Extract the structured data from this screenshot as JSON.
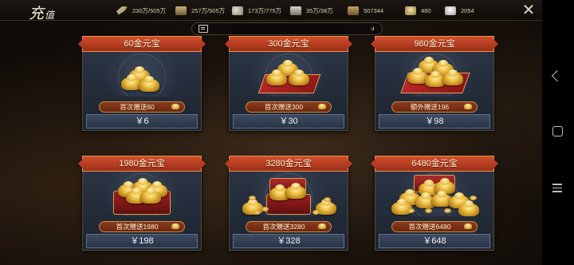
{
  "header": {
    "title_main": "充",
    "title_sub": "值",
    "close_symbol": "✕"
  },
  "resources": [
    {
      "name": "grain",
      "icon": "grain-icon",
      "value": "230万/505万"
    },
    {
      "name": "wood",
      "icon": "wood-icon",
      "value": "257万/505万"
    },
    {
      "name": "stone",
      "icon": "stone-icon",
      "value": "173万/775万"
    },
    {
      "name": "iron",
      "icon": "iron-icon",
      "value": "35万/38万"
    },
    {
      "name": "copper",
      "icon": "copper-icon",
      "value": "507344"
    },
    {
      "name": "gold",
      "icon": "gold-ingot-icon",
      "value": "480"
    },
    {
      "name": "silver",
      "icon": "silver-ingot-icon",
      "value": "2054"
    }
  ],
  "search": {
    "placeholder": "",
    "end_symbol": "ⅎ"
  },
  "packages": [
    {
      "title": "60金元宝",
      "bonus": "首次赠送60",
      "price": "￥6"
    },
    {
      "title": "300金元宝",
      "bonus": "首次赠送300",
      "price": "￥30"
    },
    {
      "title": "980金元宝",
      "bonus": "额外赠送196",
      "price": "￥98"
    },
    {
      "title": "1980金元宝",
      "bonus": "首次赠送1980",
      "price": "￥198"
    },
    {
      "title": "3280金元宝",
      "bonus": "首次赠送3280",
      "price": "￥328"
    },
    {
      "title": "6480金元宝",
      "bonus": "首次赠送6480",
      "price": "￥648"
    }
  ],
  "colors": {
    "header_red": "#c0421f",
    "price_blue": "#34405a",
    "gold": "#f0c24a"
  }
}
